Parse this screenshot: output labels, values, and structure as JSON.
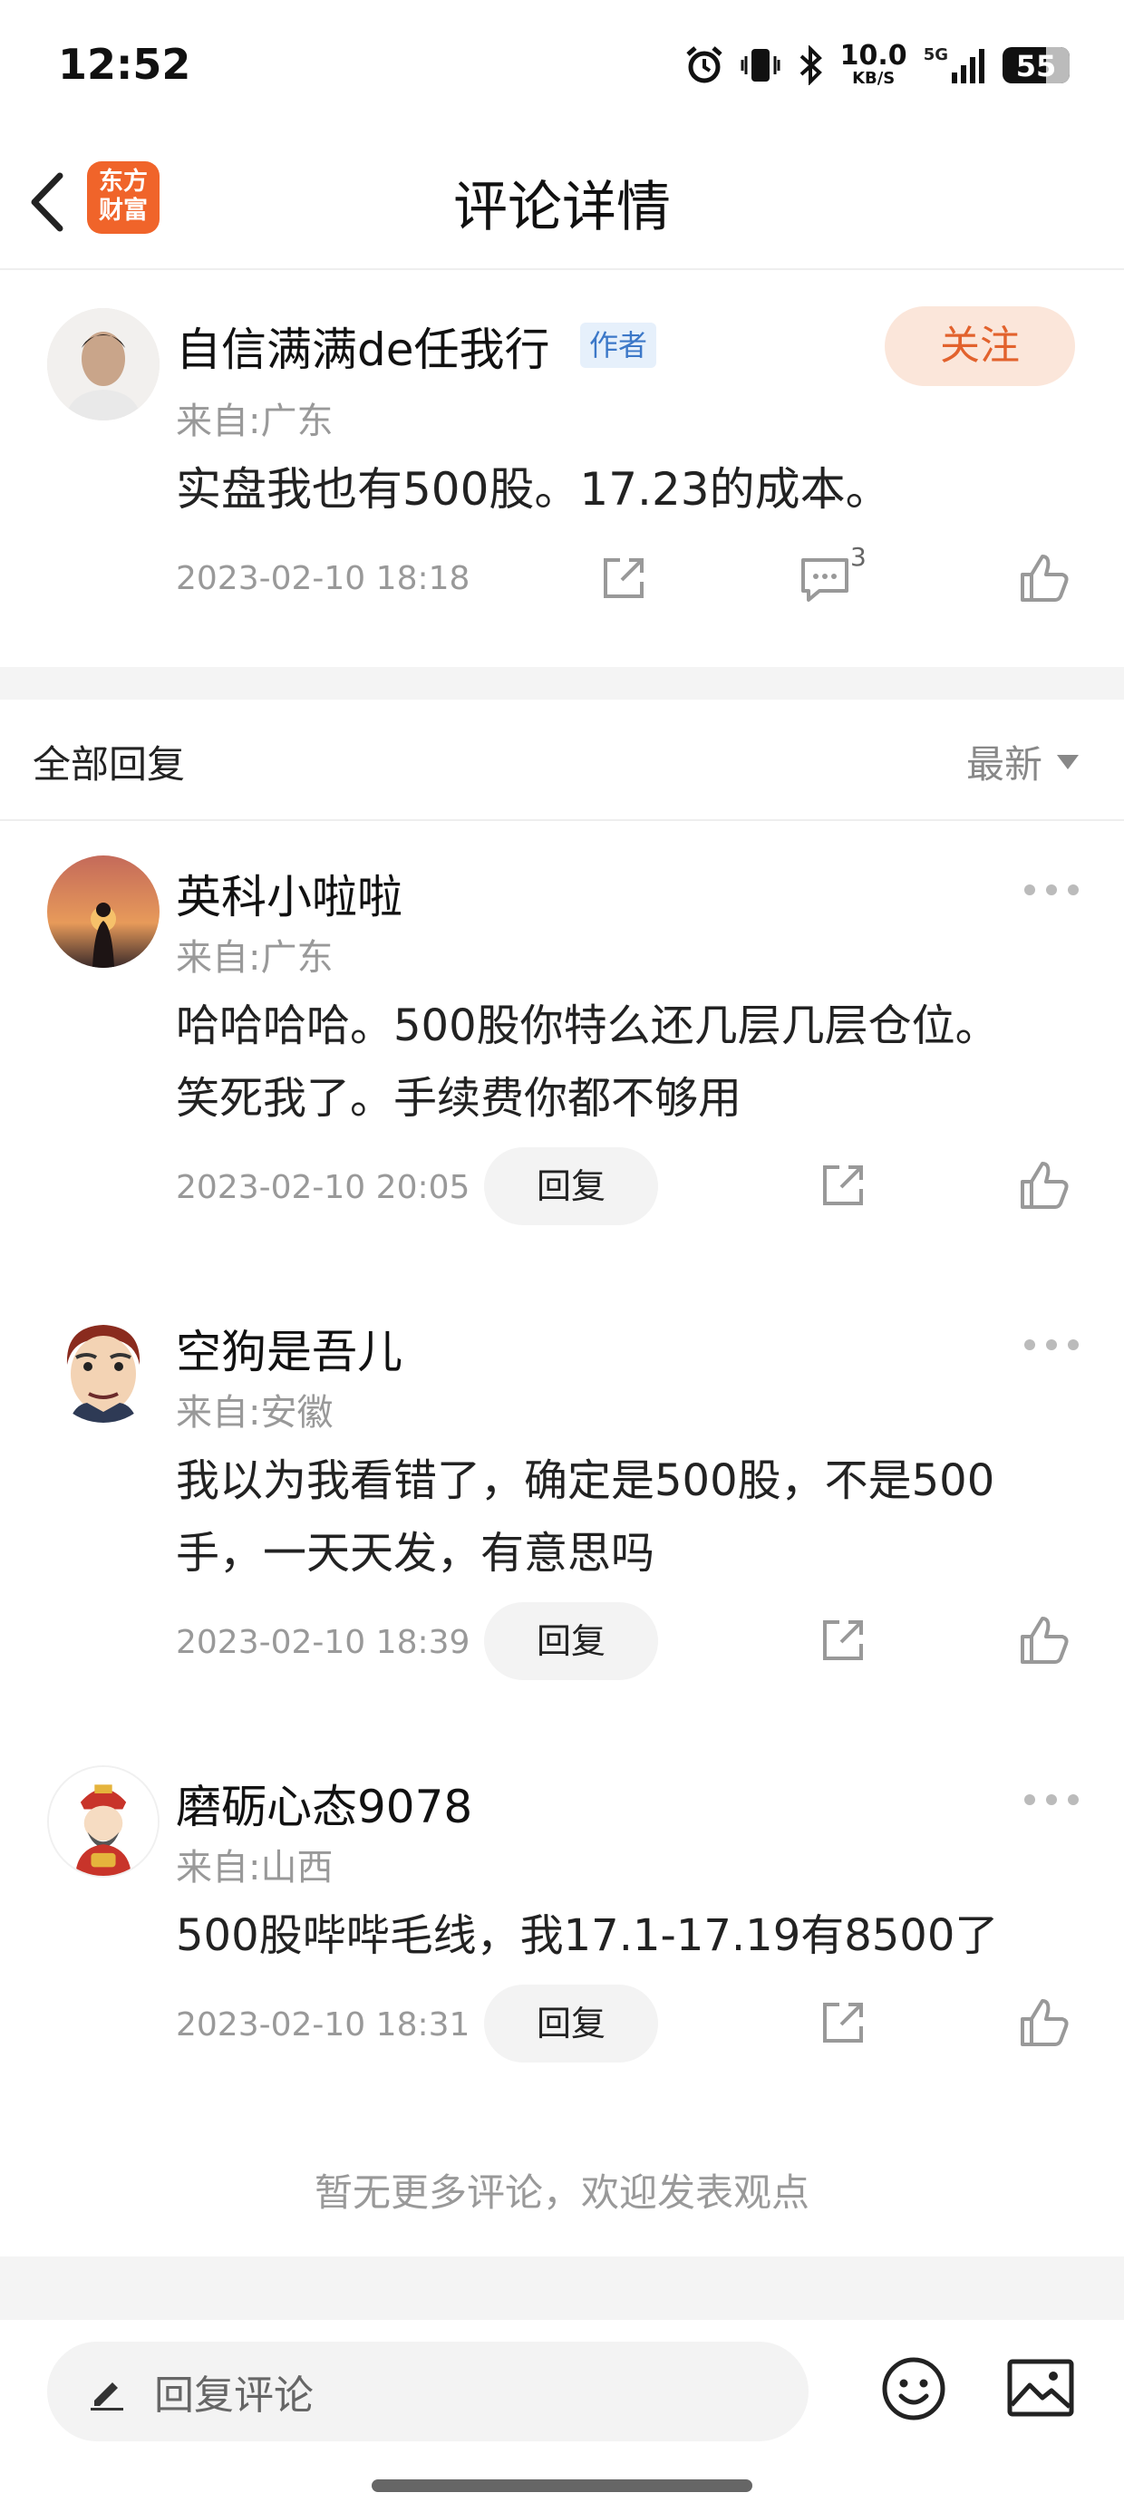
{
  "status_bar": {
    "time": "12:52",
    "net_speed_value": "10.0",
    "net_speed_unit": "KB/S",
    "network": "5G",
    "battery": "55"
  },
  "header": {
    "logo_line1": "东方",
    "logo_line2": "财富",
    "title": "评论详情"
  },
  "main_comment": {
    "username": "自信满满de任我行",
    "author_tag": "作者",
    "follow_label": "关注",
    "location": "来自:广东",
    "text": "实盘我也有500股。17.23的成本。",
    "timestamp": "2023-02-10 18:18",
    "reply_count": "3"
  },
  "replies_section": {
    "title": "全部回复",
    "sort_label": "最新"
  },
  "replies": [
    {
      "username": "英科小啦啦",
      "location": "来自:广东",
      "text_line1": "哈哈哈哈。500股你特么还几层几层仓位。",
      "text_line2": "笑死我了。手续费你都不够用",
      "timestamp": "2023-02-10 20:05",
      "reply_label": "回复"
    },
    {
      "username": "空狗是吾儿",
      "location": "来自:安徽",
      "text_line1": "我以为我看错了，确定是500股，不是500",
      "text_line2": "手，一天天发，有意思吗",
      "timestamp": "2023-02-10 18:39",
      "reply_label": "回复"
    },
    {
      "username": "磨砺心态9078",
      "location": "来自:山西",
      "text_line1": "500股哔哔毛线，我17.1-17.19有8500了",
      "timestamp": "2023-02-10 18:31",
      "reply_label": "回复"
    }
  ],
  "footer_note": "暂无更多评论，欢迎发表观点",
  "bottom_bar": {
    "input_placeholder": "回复评论"
  },
  "colors": {
    "accent": "#f0642a",
    "follow_text": "#e2622d",
    "follow_bg": "#fbe6da",
    "author_tag_bg": "#e6f0fb",
    "author_tag_text": "#3c78c8"
  }
}
